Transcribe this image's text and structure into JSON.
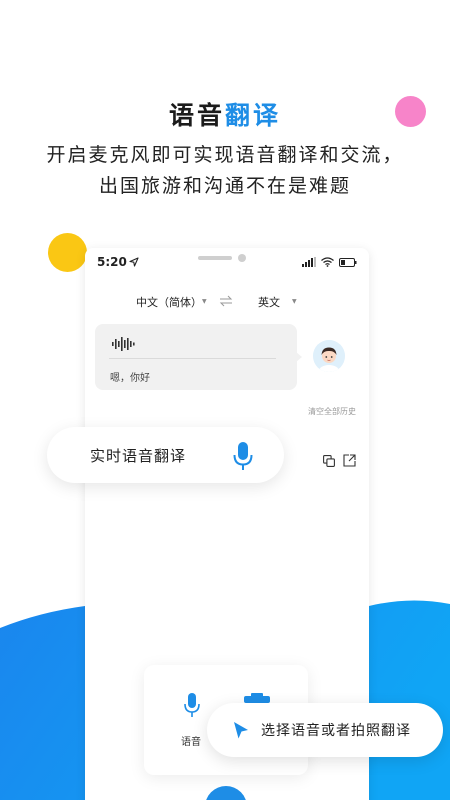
{
  "header": {
    "title_part1": "语音",
    "title_part2": "翻译",
    "subtitle": "开启麦克风即可实现语音翻译和交流，出国旅游和沟通不在是难题"
  },
  "phone": {
    "status": {
      "time": "5:20"
    },
    "languages": {
      "source": "中文（简体）",
      "target": "英文"
    },
    "message": {
      "text": "嗯，你好"
    },
    "clear_history": "清空全部历史",
    "bottom_panel": {
      "voice_label": "语音"
    }
  },
  "cards": {
    "realtime_label": "实时语音翻译",
    "select_label": "选择语音或者拍照翻译"
  },
  "colors": {
    "accent": "#1e8de6",
    "pink_dot": "#f784c9",
    "yellow_dot": "#fac714"
  },
  "icons": [
    "microphone-icon",
    "cursor-arrow-icon",
    "swap-icon",
    "copy-icon",
    "share-icon",
    "voice-wave-icon",
    "navigation-arrow-icon",
    "signal-icon",
    "wifi-icon",
    "battery-icon",
    "camera-icon"
  ]
}
